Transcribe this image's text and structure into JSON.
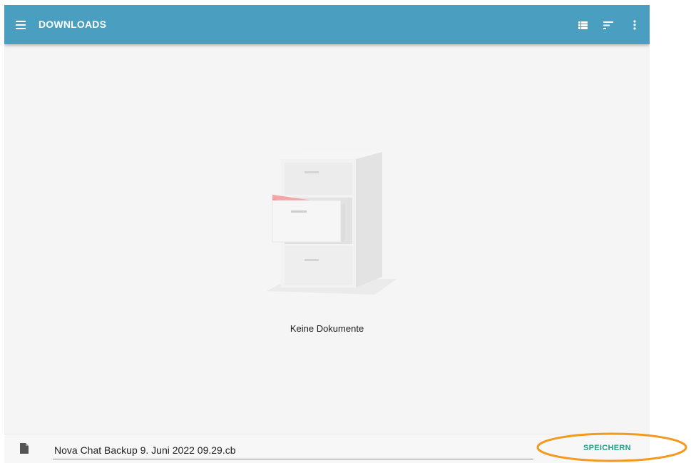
{
  "appbar": {
    "title": "DOWNLOADS",
    "menu_icon": "hamburger-menu-icon",
    "actions": [
      {
        "name": "list-view-icon"
      },
      {
        "name": "sort-icon"
      },
      {
        "name": "more-vert-icon"
      }
    ],
    "color": "#4a9fc0"
  },
  "empty_state": {
    "illustration": "file-cabinet-icon",
    "message": "Keine Dokumente"
  },
  "save_bar": {
    "file_icon": "document-icon",
    "filename": "Nova Chat Backup 9. Juni 2022 09.29.cb",
    "save_label": "SPEICHERN",
    "accent_color": "#23a08c"
  },
  "annotation": {
    "highlight_color": "#f39a1e"
  }
}
